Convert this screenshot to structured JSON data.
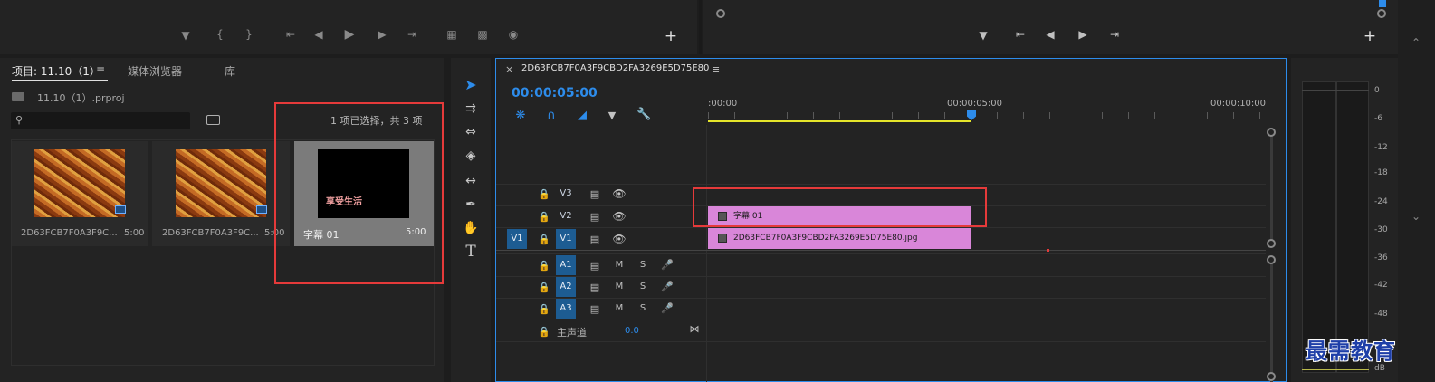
{
  "source_monitor": {
    "transport": [
      "marker-icon",
      "mark-in-icon",
      "mark-out-icon",
      "go-to-in-icon",
      "step-back-icon",
      "play-icon",
      "step-forward-icon",
      "go-to-out-icon",
      "insert-icon",
      "overwrite-icon",
      "export-frame-icon"
    ],
    "add_label": "+"
  },
  "program_monitor": {
    "add_label": "+"
  },
  "project_panel": {
    "tabs": [
      "项目: 11.10（1）",
      "媒体浏览器",
      "库"
    ],
    "menu_icon": "≡",
    "file_name": "11.10（1）.prproj",
    "search_placeholder": "",
    "selection_status": "1 项已选择，共 3 项",
    "items": [
      {
        "name": "2D63FCB7F0A3F9C...",
        "duration": "5:00",
        "type": "image"
      },
      {
        "name": "2D63FCB7F0A3F9C...",
        "duration": "5:00",
        "type": "image"
      },
      {
        "name": "字幕 01",
        "duration": "5:00",
        "type": "title",
        "preview_text": "享受生活"
      }
    ]
  },
  "timeline": {
    "sequence_name": "2D63FCB7F0A3F9CBD2FA3269E5D75E80",
    "menu_icon": "≡",
    "close_icon": "×",
    "timecode": "00:00:05:00",
    "ruler": [
      ":00:00",
      "00:00:05:00",
      "00:00:10:00"
    ],
    "video_tracks": [
      {
        "source": "",
        "name": "V3"
      },
      {
        "source": "",
        "name": "V2"
      },
      {
        "source": "V1",
        "name": "V1"
      }
    ],
    "audio_tracks": [
      {
        "name": "A1",
        "m": "M",
        "s": "S"
      },
      {
        "name": "A2",
        "m": "M",
        "s": "S"
      },
      {
        "name": "A3",
        "m": "M",
        "s": "S"
      }
    ],
    "master": {
      "label": "主声道",
      "value": "0.0"
    },
    "clips": {
      "v2": "字幕 01",
      "v1": "2D63FCB7F0A3F9CBD2FA3269E5D75E80.jpg"
    }
  },
  "audio_meter": {
    "scale": [
      "0",
      "-6",
      "-12",
      "-18",
      "-24",
      "-30",
      "-36",
      "-42",
      "-48",
      "dB"
    ]
  },
  "watermark": "最需教育",
  "colors": {
    "accent_blue": "#2d8ceb",
    "clip_pink": "#d986d9",
    "highlight_red": "#e53a3a",
    "playhead_yellow": "#e5e52a"
  }
}
